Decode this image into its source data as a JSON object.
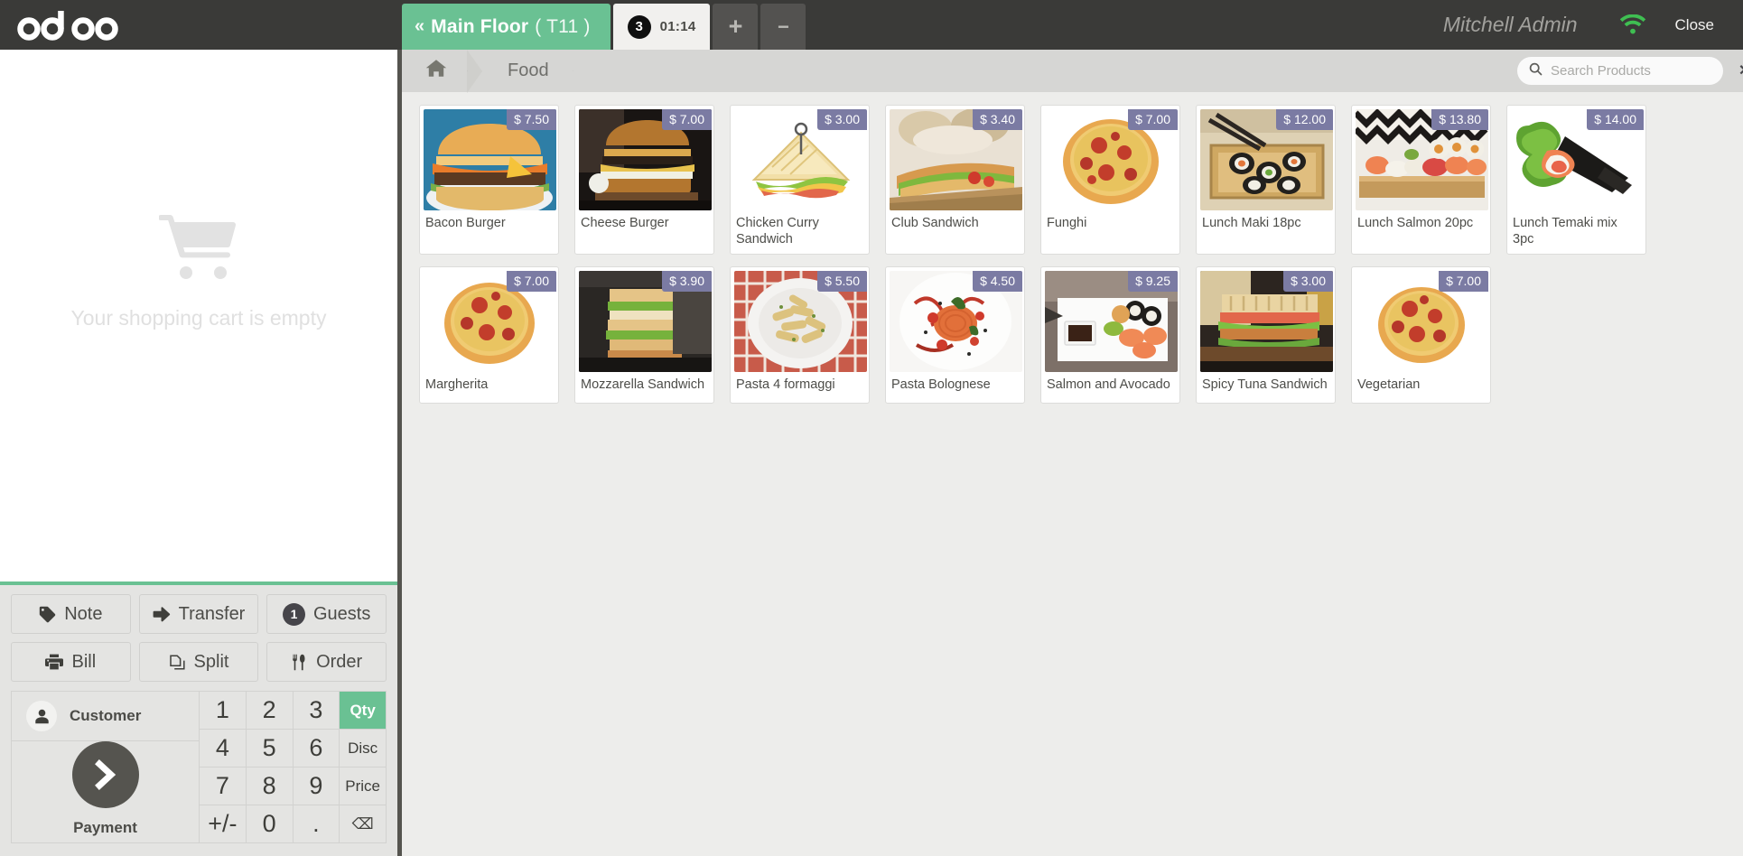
{
  "app": {
    "brand": "odoo"
  },
  "topbar": {
    "floor_tab": {
      "chevron": "«",
      "floor_name": "Main Floor",
      "table": "( T11 )",
      "icon": "double-chevron-left-icon"
    },
    "order_tab": {
      "guests": "3",
      "timer": "01:14"
    },
    "add_order_label": "+",
    "remove_order_label": "−",
    "user": "Mitchell Admin",
    "wifi_icon": "wifi-icon",
    "close_label": "Close",
    "colors": {
      "floor_tab_bg": "#6ac193",
      "order_tab_bg": "#f1f0ee",
      "bar_bg": "#3a3a38",
      "wifi": "#3fbf52"
    }
  },
  "order_panel": {
    "empty_cart_icon": "shopping-cart-icon",
    "empty_text": "Your shopping cart is empty",
    "actions": [
      {
        "label": "Note",
        "icon": "tag-icon"
      },
      {
        "label": "Transfer",
        "icon": "arrow-right-icon"
      },
      {
        "label": "Guests",
        "icon": "guest-count-badge",
        "badge": "1"
      },
      {
        "label": "Bill",
        "icon": "printer-icon"
      },
      {
        "label": "Split",
        "icon": "copy-icon"
      },
      {
        "label": "Order",
        "icon": "cutlery-icon"
      }
    ],
    "customer": {
      "label": "Customer",
      "icon": "person-icon"
    },
    "payment": {
      "label": "Payment",
      "icon": "chevron-right-icon"
    },
    "numpad": [
      {
        "label": "1",
        "kind": "digit"
      },
      {
        "label": "2",
        "kind": "digit"
      },
      {
        "label": "3",
        "kind": "digit"
      },
      {
        "label": "Qty",
        "kind": "mode",
        "active": true
      },
      {
        "label": "4",
        "kind": "digit"
      },
      {
        "label": "5",
        "kind": "digit"
      },
      {
        "label": "6",
        "kind": "digit"
      },
      {
        "label": "Disc",
        "kind": "mode",
        "active": false
      },
      {
        "label": "7",
        "kind": "digit"
      },
      {
        "label": "8",
        "kind": "digit"
      },
      {
        "label": "9",
        "kind": "digit"
      },
      {
        "label": "Price",
        "kind": "mode",
        "active": false
      },
      {
        "label": "+/-",
        "kind": "sign"
      },
      {
        "label": "0",
        "kind": "digit"
      },
      {
        "label": ".",
        "kind": "digit"
      },
      {
        "label": "⌫",
        "kind": "backspace"
      }
    ]
  },
  "products_panel": {
    "breadcrumb": {
      "home_icon": "home-icon",
      "category": "Food"
    },
    "search": {
      "placeholder": "Search Products",
      "value": "",
      "icon": "search-icon",
      "clear_icon": "close-icon"
    },
    "products": [
      {
        "name": "Bacon Burger",
        "price": "$ 7.50",
        "image": "bacon-burger"
      },
      {
        "name": "Cheese Burger",
        "price": "$ 7.00",
        "image": "cheese-burger"
      },
      {
        "name": "Chicken Curry Sandwich",
        "price": "$ 3.00",
        "image": "chicken-curry-sandwich"
      },
      {
        "name": "Club Sandwich",
        "price": "$ 3.40",
        "image": "club-sandwich"
      },
      {
        "name": "Funghi",
        "price": "$ 7.00",
        "image": "funghi-pizza"
      },
      {
        "name": "Lunch Maki 18pc",
        "price": "$ 12.00",
        "image": "lunch-maki"
      },
      {
        "name": "Lunch Salmon 20pc",
        "price": "$ 13.80",
        "image": "lunch-salmon"
      },
      {
        "name": "Lunch Temaki mix 3pc",
        "price": "$ 14.00",
        "image": "lunch-temaki"
      },
      {
        "name": "Margherita",
        "price": "$ 7.00",
        "image": "margherita-pizza"
      },
      {
        "name": "Mozzarella Sandwich",
        "price": "$ 3.90",
        "image": "mozzarella-sandwich"
      },
      {
        "name": "Pasta 4 formaggi",
        "price": "$ 5.50",
        "image": "pasta-4-formaggi"
      },
      {
        "name": "Pasta Bolognese",
        "price": "$ 4.50",
        "image": "pasta-bolognese"
      },
      {
        "name": "Salmon and Avocado",
        "price": "$ 9.25",
        "image": "salmon-avocado"
      },
      {
        "name": "Spicy Tuna Sandwich",
        "price": "$ 3.00",
        "image": "spicy-tuna-sandwich"
      },
      {
        "name": "Vegetarian",
        "price": "$ 7.00",
        "image": "vegetarian-pizza"
      }
    ],
    "colors": {
      "price_badge": "#7b7ba3",
      "panel_bg": "#ededeb",
      "breadcrumb_bg": "#d6d6d4"
    }
  }
}
